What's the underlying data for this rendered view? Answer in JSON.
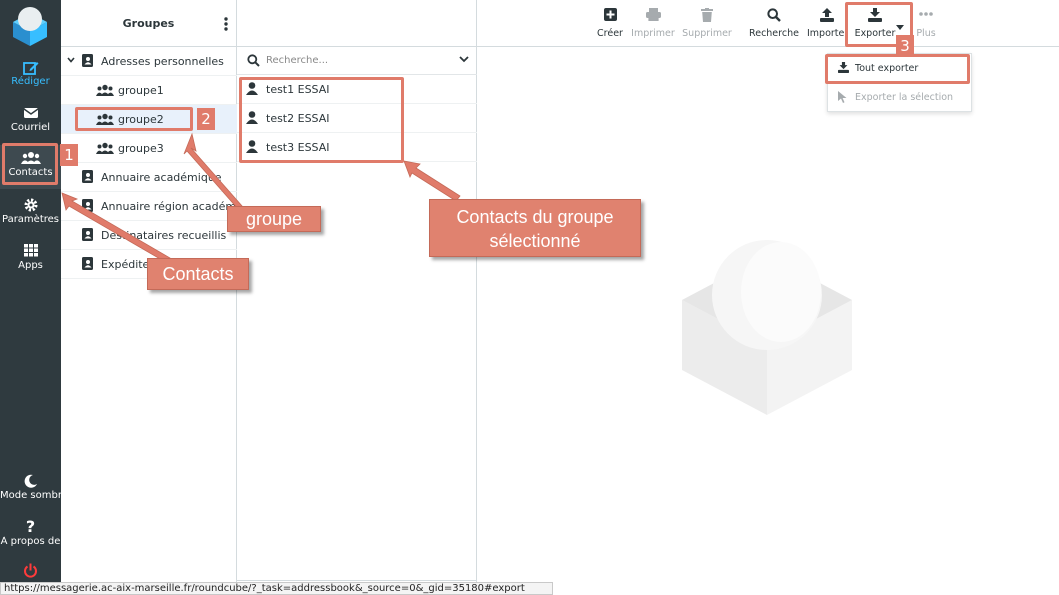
{
  "nav": {
    "items": [
      {
        "label": "Rédiger",
        "icon": "compose-icon"
      },
      {
        "label": "Courriel",
        "icon": "mail-icon"
      },
      {
        "label": "Contacts",
        "icon": "contacts-icon"
      },
      {
        "label": "Paramètres",
        "icon": "gear-icon"
      },
      {
        "label": "Apps",
        "icon": "apps-grid-icon"
      }
    ],
    "bottom": [
      {
        "label": "Mode sombre",
        "icon": "moon-icon"
      },
      {
        "label": "À propos de",
        "icon": "question-icon"
      }
    ]
  },
  "groups": {
    "title": "Groupes",
    "items": [
      {
        "label": "Adresses personnelles"
      },
      {
        "label": "groupe1"
      },
      {
        "label": "groupe2"
      },
      {
        "label": "groupe3"
      },
      {
        "label": "Annuaire académique"
      },
      {
        "label": "Annuaire région académ..."
      },
      {
        "label": "Destinataires recueillis"
      },
      {
        "label": "Expéditeurs"
      }
    ]
  },
  "contacts": {
    "search_placeholder": "Recherche...",
    "items": [
      {
        "name": "test1 ESSAI"
      },
      {
        "name": "test2 ESSAI"
      },
      {
        "name": "test3 ESSAI"
      }
    ]
  },
  "toolbar": {
    "create": "Créer",
    "print": "Imprimer",
    "delete": "Supprimer",
    "search": "Recherche",
    "import": "Importer",
    "export": "Exporter",
    "more": "Plus"
  },
  "export_menu": {
    "export_all": "Tout exporter",
    "export_selection": "Exporter la sélection"
  },
  "statusbar": {
    "url": "https://messagerie.ac-aix-marseille.fr/roundcube/?_task=addressbook&_source=0&_gid=35180#export"
  },
  "annotations": {
    "numbers": [
      "1",
      "2",
      "3"
    ],
    "callouts": {
      "contacts": "Contacts",
      "groupe": "groupe",
      "group_contacts_line1": "Contacts du groupe",
      "group_contacts_line2": "sélectionné"
    }
  },
  "colors": {
    "nav_bg": "#2f3a3f",
    "accent": "#37beff",
    "annotation": "#e07b6a"
  }
}
